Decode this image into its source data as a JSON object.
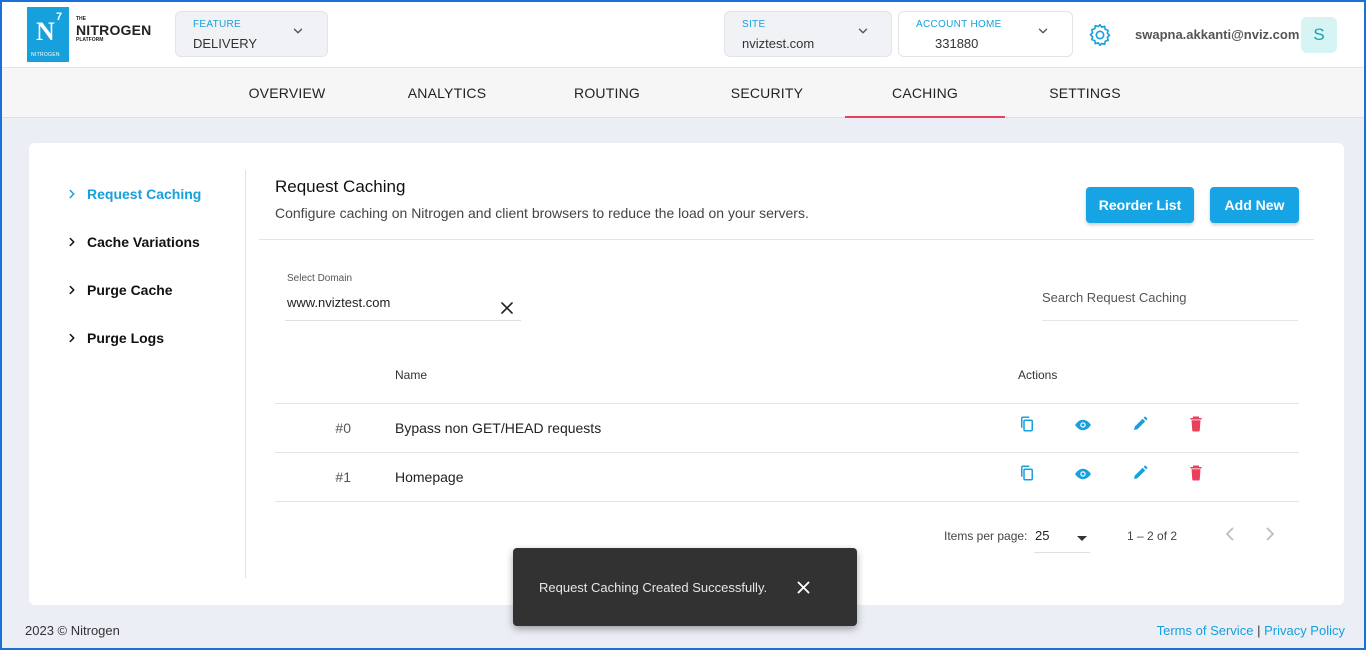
{
  "brand": {
    "logo_mark": "N",
    "logo_sup": "7",
    "logo_small": "NITROGEN",
    "the": "THE",
    "name": "NITROGEN",
    "platform": "PLATFORM"
  },
  "header": {
    "feature": {
      "label": "FEATURE",
      "value": "DELIVERY"
    },
    "site": {
      "label": "SITE",
      "value": "nviztest.com"
    },
    "account": {
      "label": "ACCOUNT HOME",
      "value": "331880"
    },
    "settings_icon": "gear-icon",
    "email": "swapna.akkanti@nviz.com",
    "avatar": "S"
  },
  "nav": {
    "tabs": [
      {
        "label": "OVERVIEW"
      },
      {
        "label": "ANALYTICS"
      },
      {
        "label": "ROUTING"
      },
      {
        "label": "SECURITY"
      },
      {
        "label": "CACHING"
      },
      {
        "label": "SETTINGS"
      }
    ],
    "active": "CACHING",
    "accent": "#e8405b"
  },
  "sidebar": {
    "items": [
      {
        "label": "Request Caching"
      },
      {
        "label": "Cache Variations"
      },
      {
        "label": "Purge Cache"
      },
      {
        "label": "Purge Logs"
      }
    ],
    "active": "Request Caching"
  },
  "main": {
    "title": "Request Caching",
    "description": "Configure caching on Nitrogen and client browsers to reduce the load on your servers.",
    "reorder_label": "Reorder List",
    "add_label": "Add New",
    "domain": {
      "label": "Select Domain",
      "value": "www.nviztest.com"
    },
    "search_placeholder": "Search Request Caching",
    "columns": {
      "name": "Name",
      "actions": "Actions"
    },
    "rows": [
      {
        "index": "#0",
        "name": "Bypass non GET/HEAD requests"
      },
      {
        "index": "#1",
        "name": "Homepage"
      }
    ],
    "action_icons": [
      "copy-icon",
      "view-icon",
      "edit-icon",
      "delete-icon"
    ],
    "pagination": {
      "items_label": "Items per page:",
      "page_size": "25",
      "range": "1 – 2 of 2"
    }
  },
  "footer": {
    "copyright": "2023 © Nitrogen",
    "terms": "Terms of Service",
    "separator": "|",
    "privacy": "Privacy Policy"
  },
  "toast": {
    "message": "Request Caching Created Successfully."
  },
  "colors": {
    "accent": "#16a0dc",
    "danger": "#e8405b",
    "toast_bg": "#323232"
  }
}
